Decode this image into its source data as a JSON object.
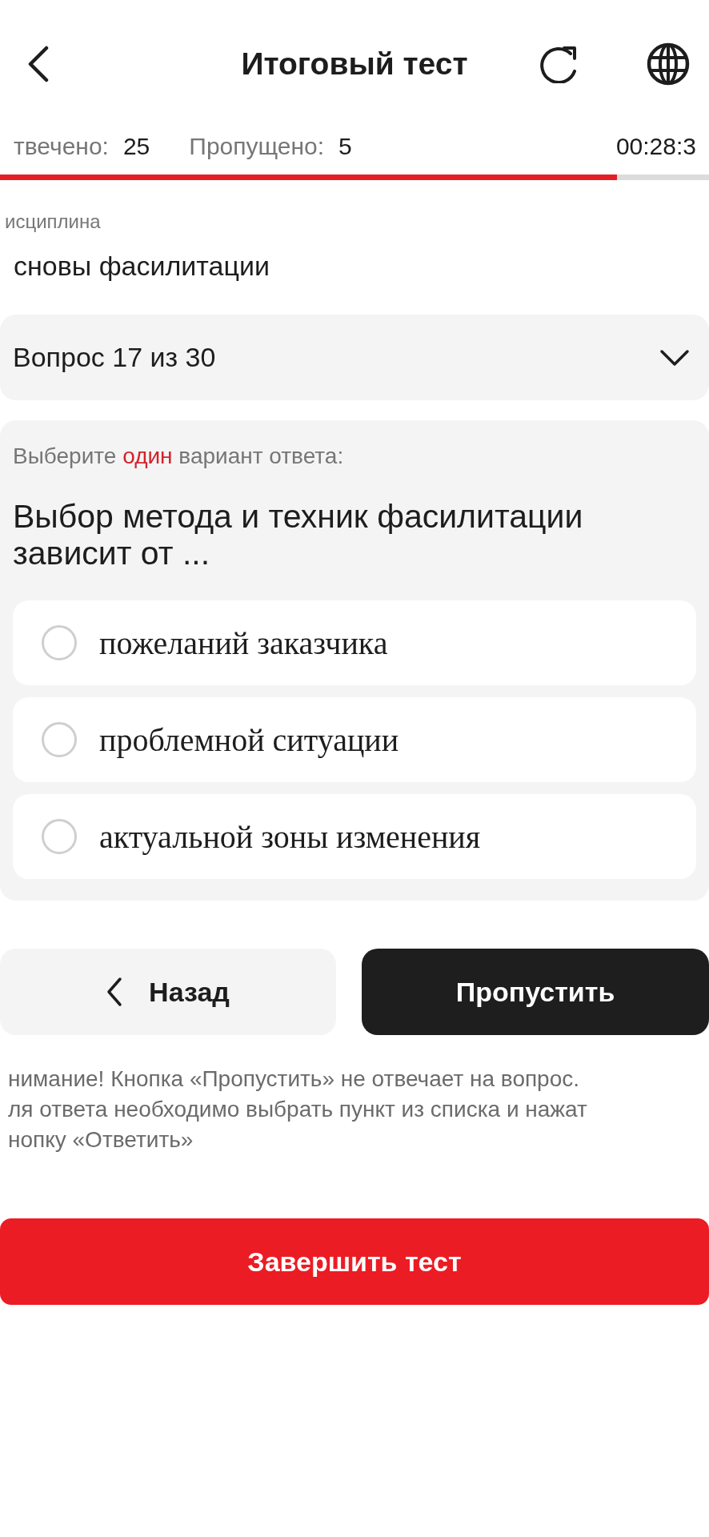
{
  "header": {
    "title": "Итоговый тест"
  },
  "stats": {
    "answered_label": "твечено:",
    "answered": "25",
    "skipped_label": "Пропущено:",
    "skipped": "5",
    "timer": "00:28:3"
  },
  "progress": {
    "level": 0.87
  },
  "discipline": {
    "label": "исциплина",
    "value": "сновы фасилитации"
  },
  "question_selector": {
    "label": "Вопрос 17 из 30",
    "expanded": false
  },
  "question": {
    "instruction": "Выберите **один** вариант ответа:",
    "text": "Выбор метода и техник фасилитации зависит от ...",
    "options": [
      {
        "text": "пожеланий заказчика",
        "selected": false
      },
      {
        "text": "проблемной ситуации",
        "selected": false
      },
      {
        "text": "актуальной зоны изменения",
        "selected": false
      }
    ]
  },
  "buttons": {
    "back": "Назад",
    "skip": "Пропустить"
  },
  "warning": "нимание! Кнопка «Пропустить» не отвечает на вопрос.\nля ответа необходимо выбрать пункт из списка и нажат\nнопку «Ответить»",
  "finish_button": "Завершить тест"
}
